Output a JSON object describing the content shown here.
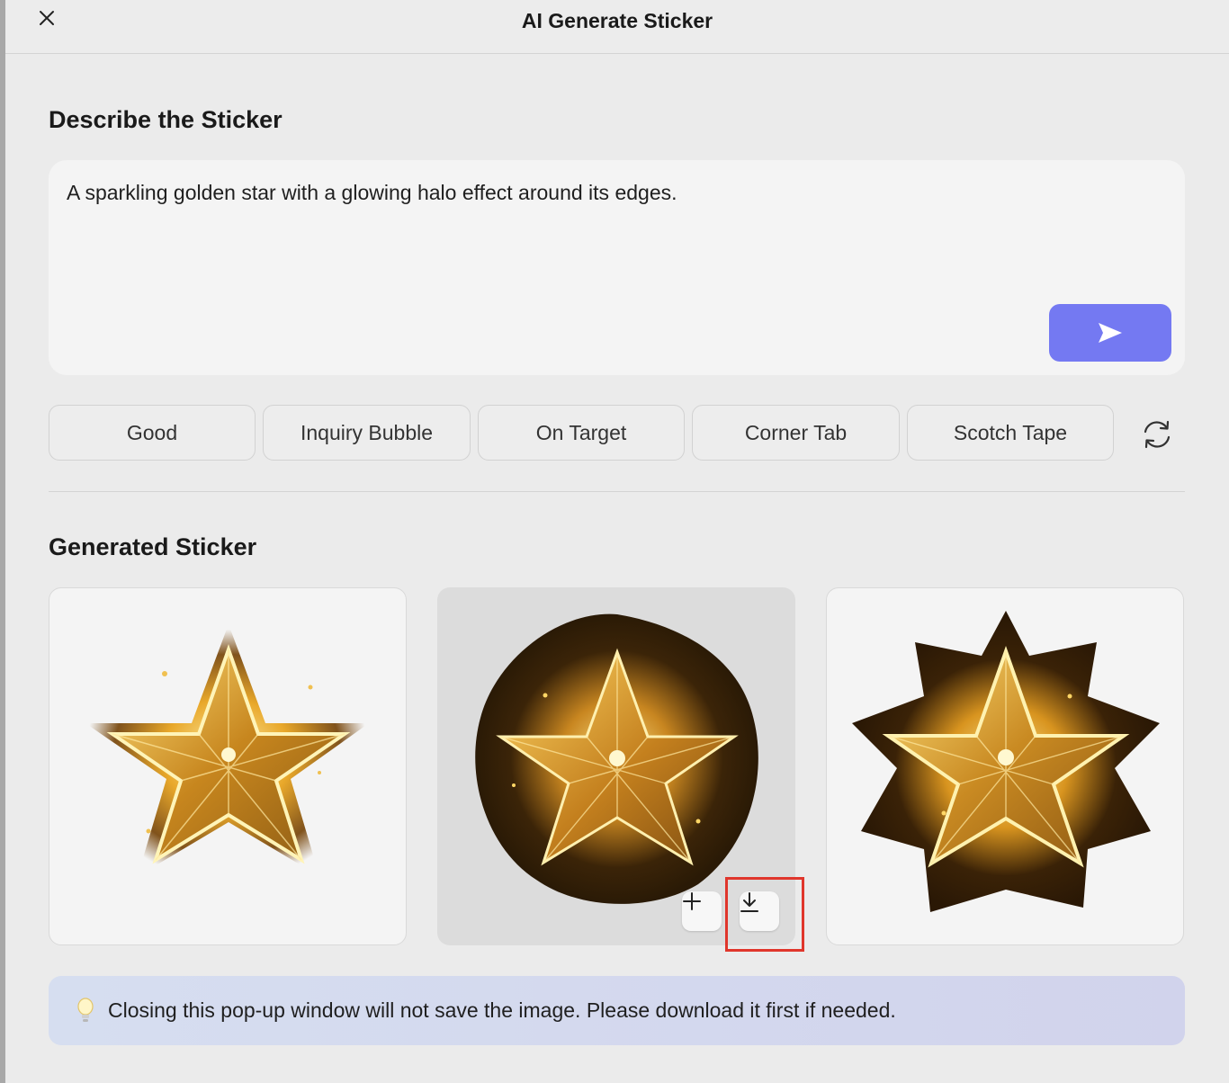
{
  "dialog": {
    "title": "AI Generate Sticker",
    "close_icon": "close-icon"
  },
  "describe": {
    "heading": "Describe the Sticker",
    "prompt_value": "A sparkling golden star with a glowing halo effect around its edges.",
    "send_icon": "send-icon",
    "send_color": "#7479f2"
  },
  "suggestions": {
    "chips": [
      "Good",
      "Inquiry Bubble",
      "On Target",
      "Corner Tab",
      "Scotch Tape"
    ],
    "refresh_icon": "refresh-icon"
  },
  "generated": {
    "heading": "Generated Sticker",
    "stickers": [
      {
        "image": "golden-star-sticker",
        "style": "glitter-halo"
      },
      {
        "image": "golden-star-sticker",
        "style": "dark-dust-halo",
        "hovered": true
      },
      {
        "image": "golden-star-sticker",
        "style": "burst-halo"
      }
    ],
    "actions": {
      "add_icon": "plus-icon",
      "download_icon": "download-icon"
    },
    "highlight_color": "#e0362c"
  },
  "notice": {
    "icon": "lightbulb-icon",
    "text": "Closing this pop-up window will not save the image. Please download it first if needed."
  }
}
